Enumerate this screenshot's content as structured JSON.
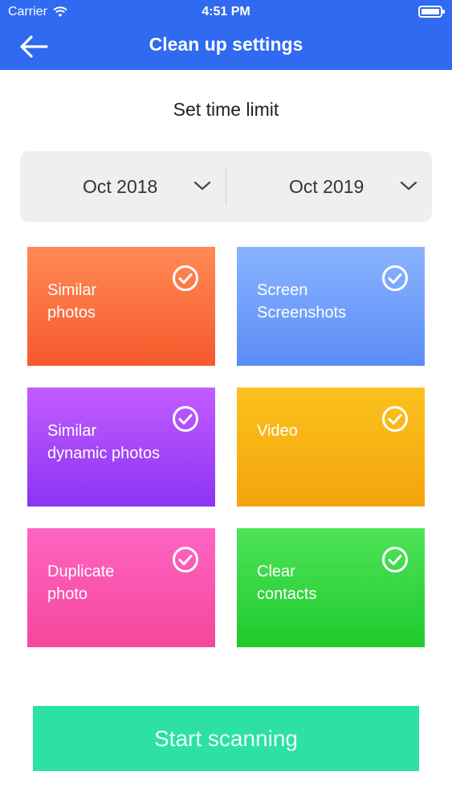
{
  "status_bar": {
    "carrier": "Carrier",
    "time": "4:51 PM"
  },
  "nav": {
    "title": "Clean up settings",
    "back_icon": "back-arrow-icon"
  },
  "time_limit": {
    "label": "Set time limit",
    "from": "Oct 2018",
    "to": "Oct 2019"
  },
  "tiles": [
    {
      "label": "Similar\nphotos",
      "checked": true,
      "color": "#f76a3a"
    },
    {
      "label": "Screen\nScreenshots",
      "checked": true,
      "color": "#6f9bfb"
    },
    {
      "label": "Similar\ndynamic photos",
      "checked": true,
      "color": "#a346f7"
    },
    {
      "label": "Video",
      "checked": true,
      "color": "#f7b316"
    },
    {
      "label": "Duplicate\nphoto",
      "checked": true,
      "color": "#fa55ae"
    },
    {
      "label": "Clear\ncontacts",
      "checked": true,
      "color": "#34d440"
    }
  ],
  "actions": {
    "start_label": "Start scanning"
  },
  "colors": {
    "nav_bg": "#2f6af0",
    "start_bg": "#2de0a6"
  }
}
